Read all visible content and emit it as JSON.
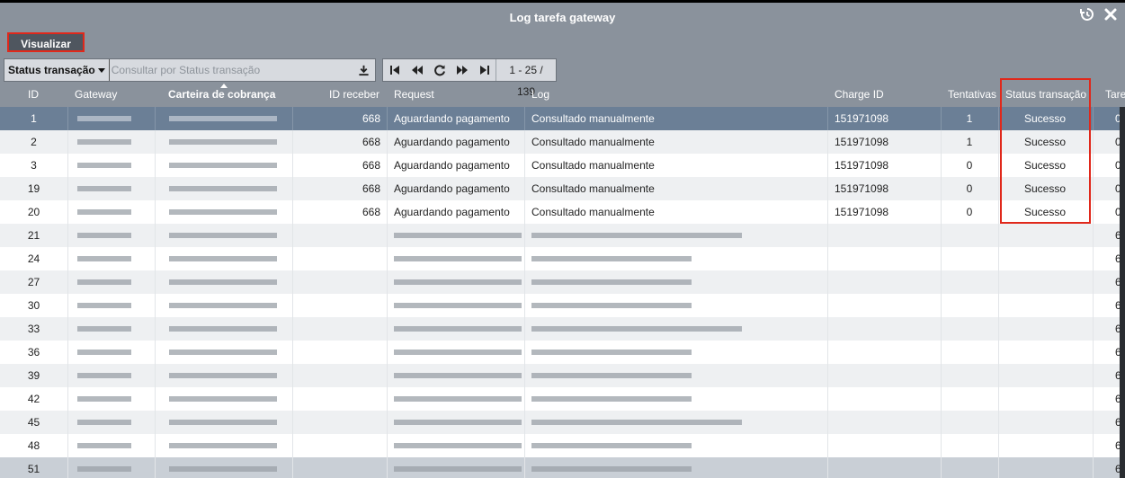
{
  "window": {
    "title": "Log tarefa gateway",
    "icons": [
      "history-icon",
      "close-icon"
    ]
  },
  "toolbar": {
    "view_label": "Visualizar"
  },
  "filter": {
    "field_label": "Status transação",
    "placeholder": "Consultar por Status transação",
    "icon": "download-icon"
  },
  "pager": {
    "count_text": "1 - 25 / 139",
    "icons": [
      "first-page-icon",
      "prev-page-icon",
      "refresh-icon",
      "next-page-icon",
      "last-page-icon"
    ]
  },
  "table": {
    "columns": {
      "id": "ID",
      "gateway": "Gateway",
      "carteira": "Carteira de cobrança",
      "id_receber": "ID receber",
      "request": "Request",
      "log": "Log",
      "charge_id": "Charge ID",
      "tentativas": "Tentativas",
      "status": "Status transação",
      "tarefa": "Tare"
    },
    "rows": [
      {
        "id": "1",
        "id_receber": "668",
        "request": "Aguardando pagamento",
        "log": "Consultado manualmente",
        "charge_id": "151971098",
        "tentativas": "1",
        "status": "Sucesso",
        "tarefa": "0"
      },
      {
        "id": "2",
        "id_receber": "668",
        "request": "Aguardando pagamento",
        "log": "Consultado manualmente",
        "charge_id": "151971098",
        "tentativas": "1",
        "status": "Sucesso",
        "tarefa": "0"
      },
      {
        "id": "3",
        "id_receber": "668",
        "request": "Aguardando pagamento",
        "log": "Consultado manualmente",
        "charge_id": "151971098",
        "tentativas": "0",
        "status": "Sucesso",
        "tarefa": "0"
      },
      {
        "id": "19",
        "id_receber": "668",
        "request": "Aguardando pagamento",
        "log": "Consultado manualmente",
        "charge_id": "151971098",
        "tentativas": "0",
        "status": "Sucesso",
        "tarefa": "0"
      },
      {
        "id": "20",
        "id_receber": "668",
        "request": "Aguardando pagamento",
        "log": "Consultado manualmente",
        "charge_id": "151971098",
        "tentativas": "0",
        "status": "Sucesso",
        "tarefa": "0"
      },
      {
        "id": "21",
        "tarefa": "6"
      },
      {
        "id": "24",
        "tarefa": "6"
      },
      {
        "id": "27",
        "tarefa": "6"
      },
      {
        "id": "30",
        "tarefa": "6"
      },
      {
        "id": "33",
        "tarefa": "6"
      },
      {
        "id": "36",
        "tarefa": "6"
      },
      {
        "id": "39",
        "tarefa": "6"
      },
      {
        "id": "42",
        "tarefa": "6"
      },
      {
        "id": "45",
        "tarefa": "6"
      },
      {
        "id": "48",
        "tarefa": "6"
      },
      {
        "id": "51",
        "tarefa": "6"
      }
    ]
  }
}
